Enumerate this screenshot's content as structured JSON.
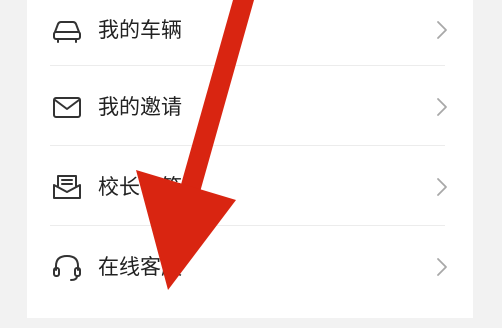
{
  "menu": {
    "items": [
      {
        "label": "我的车辆",
        "icon": "car-icon"
      },
      {
        "label": "我的邀请",
        "icon": "mail-icon"
      },
      {
        "label": "校长信箱",
        "icon": "mailbox-icon"
      },
      {
        "label": "在线客服",
        "icon": "headset-icon"
      }
    ],
    "chevron_icon": "chevron-right-icon"
  },
  "overlay": {
    "arrow_color": "#d92511"
  }
}
